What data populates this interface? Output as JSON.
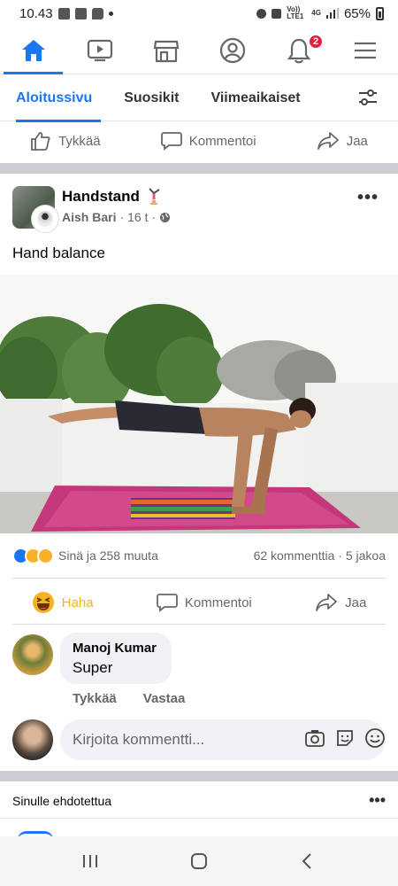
{
  "status_bar": {
    "time": "10.43",
    "network": "Vo)) LTE1",
    "signal_label": "4G",
    "battery": "65%"
  },
  "top_nav": {
    "items": [
      {
        "icon": "home-icon",
        "active": true
      },
      {
        "icon": "watch-icon",
        "active": false
      },
      {
        "icon": "marketplace-icon",
        "active": false
      },
      {
        "icon": "profile-icon",
        "active": false
      },
      {
        "icon": "bell-icon",
        "active": false,
        "badge": "2"
      },
      {
        "icon": "menu-icon",
        "active": false
      }
    ]
  },
  "feed_tabs": {
    "items": [
      "Aloitussivu",
      "Suosikit",
      "Viimeaikaiset"
    ],
    "active_index": 0
  },
  "prev_post_actions": {
    "like": "Tykkää",
    "comment": "Kommentoi",
    "share": "Jaa"
  },
  "post": {
    "group_name": "Handstand",
    "author": "Aish Bari",
    "time": "16 t",
    "text": "Hand balance",
    "reactions_text": "Sinä ja 258 muuta",
    "comments_count": "62 kommenttia",
    "shares_count": "5 jakoa",
    "actions": {
      "reaction": "Haha",
      "comment": "Kommentoi",
      "share": "Jaa"
    }
  },
  "comment": {
    "name": "Manoj Kumar",
    "text": "Super",
    "like_label": "Tykkää",
    "reply_label": "Vastaa"
  },
  "write_comment": {
    "placeholder": "Kirjoita kommentti..."
  },
  "suggested": {
    "title": "Sinulle ehdotettua"
  },
  "colors": {
    "accent": "#1877f2",
    "haha": "#f7b125",
    "badge": "#e41e3f"
  }
}
